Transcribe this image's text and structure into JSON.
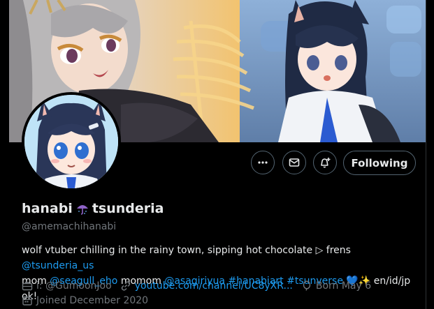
{
  "profile": {
    "display_name_first": "hanabi",
    "display_name_emoji": "☔",
    "display_name_last": "tsunderia",
    "handle": "@amemachihanabi"
  },
  "actions": {
    "more_icon": "more-horizontal-icon",
    "message_icon": "envelope-icon",
    "notify_icon": "bell-plus-icon",
    "follow_label": "Following"
  },
  "bio": {
    "line1_text": "wolf vtuber chilling in the rainy town, sipping hot chocolate ▷ frens ",
    "line1_mention": "@tsunderia_us",
    "line2_pre": "mom ",
    "line2_mention1": "@seagull_eho",
    "line2_mid": " momom ",
    "line2_mention2": "@asagiriyua",
    "line2_space1": " ",
    "line2_tag1": "#hanabiart",
    "line2_space2": " ",
    "line2_tag2": "#tsunverse",
    "line2_emoji": " 💙✨",
    "line2_end": " en/id/jp ok!"
  },
  "meta": {
    "affiliation": "i: @GumoonJoo",
    "website": "youtube.com/channel/UC8yXR...",
    "birthday": "Born May 6",
    "joined": "Joined December 2020"
  },
  "colors": {
    "background": "#000000",
    "text": "#e7e9ea",
    "muted": "#71767b",
    "link": "#1d9bf0",
    "border": "#536471"
  }
}
